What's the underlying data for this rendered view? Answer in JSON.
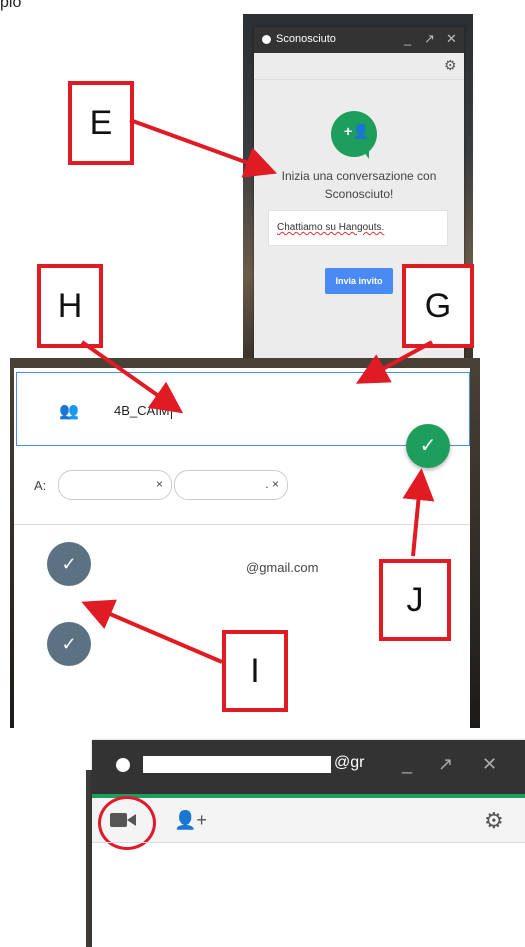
{
  "page_fragment_text": "pio",
  "callouts": {
    "E": "E",
    "H": "H",
    "G": "G",
    "J": "J",
    "I": "I"
  },
  "hangouts_window": {
    "title": "Sconosciuto",
    "start_text": "Inizia una conversazione con Sconosciuto!",
    "message": "Chattiamo su Hangouts.",
    "invite_button": "Invia invito"
  },
  "group_dialog": {
    "group_name": "4B_CAIM",
    "to_label": "A:",
    "chips": [
      {
        "remove": "×"
      },
      {
        "prefix": ".",
        "remove": "×"
      }
    ],
    "contact_email": "@gmail.com"
  },
  "chat_window": {
    "title_suffix": "@gr"
  },
  "colors": {
    "accent_green": "#1e9e5c",
    "callout_red": "#e01b24",
    "button_blue": "#4a8af4"
  }
}
